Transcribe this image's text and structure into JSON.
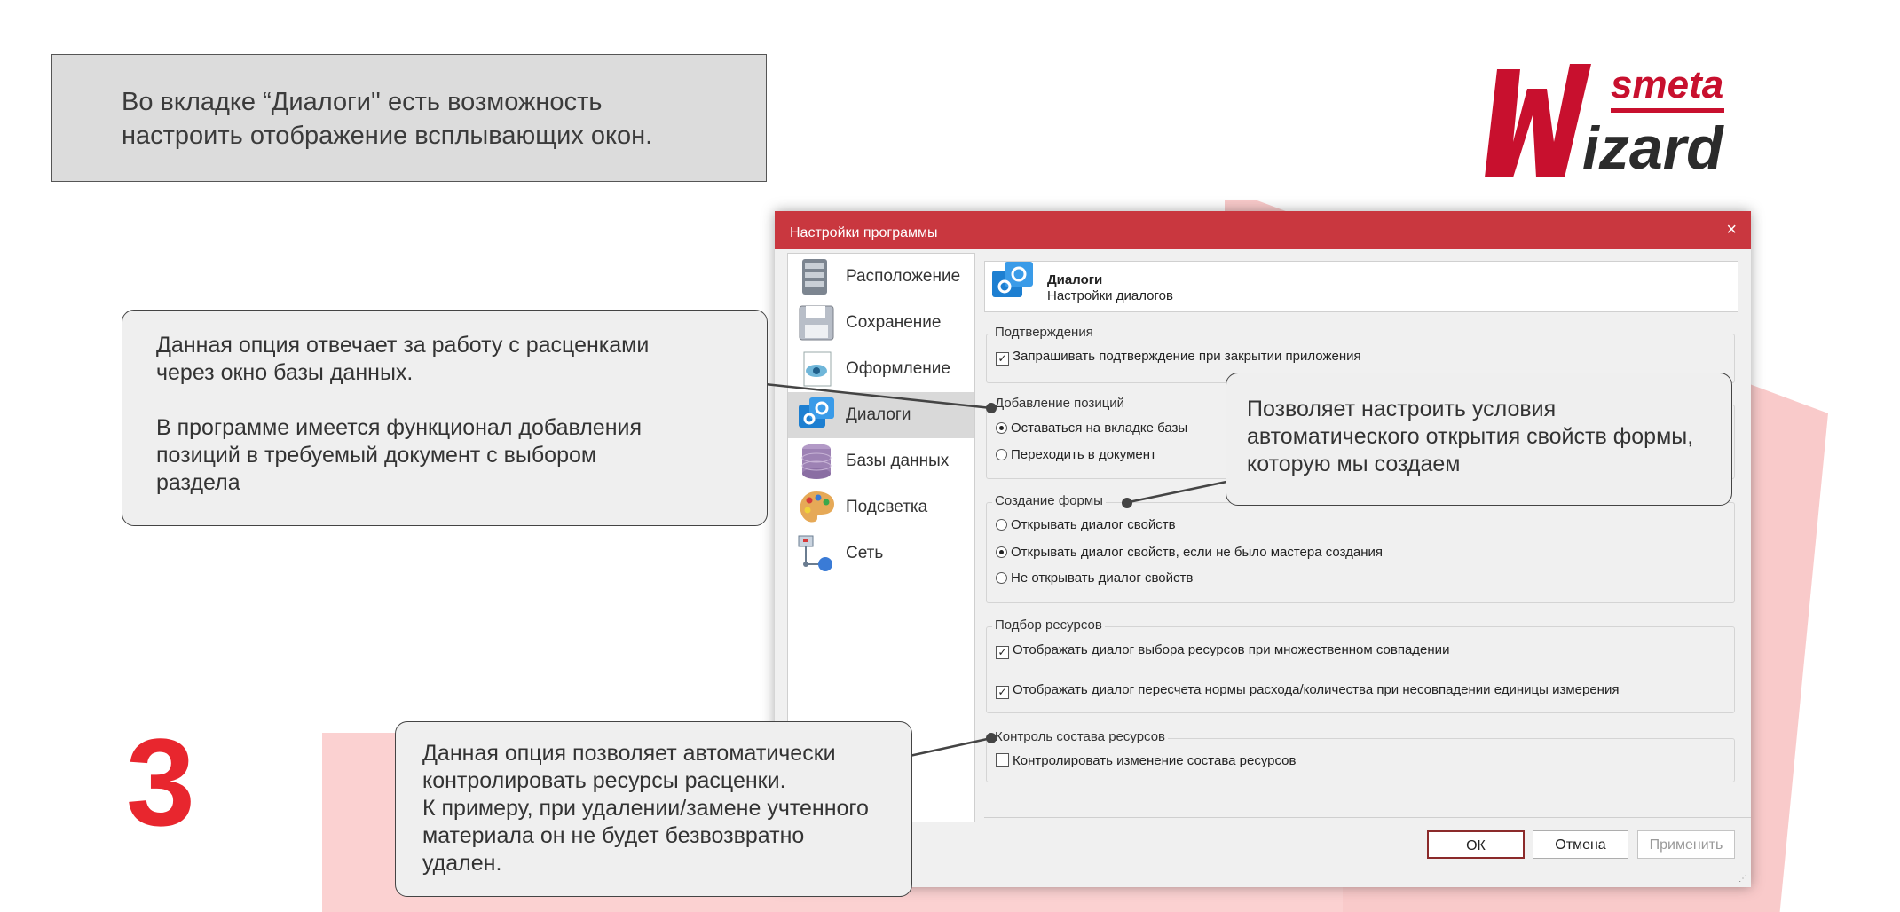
{
  "intro": {
    "line1": "Во вкладке “Диалоги'' есть возможность",
    "line2": "настроить отображение всплывающих окон."
  },
  "logo": {
    "top_text": "smeta",
    "main_text": "Wizard",
    "color": "#c8102e"
  },
  "step_number": "3",
  "window": {
    "title": "Настройки программы",
    "close": "×",
    "sidebar": [
      {
        "label": "Расположение",
        "icon": "server-icon"
      },
      {
        "label": "Сохранение",
        "icon": "floppy-disk-icon"
      },
      {
        "label": "Оформление",
        "icon": "eye-document-icon"
      },
      {
        "label": "Диалоги",
        "icon": "dialog-gear-icon",
        "active": true
      },
      {
        "label": "Базы данных",
        "icon": "database-icon"
      },
      {
        "label": "Подсветка",
        "icon": "palette-icon"
      },
      {
        "label": "Сеть",
        "icon": "network-icon"
      }
    ],
    "panel": {
      "title": "Диалоги",
      "subtitle": "Настройки диалогов"
    },
    "groups": {
      "confirm": {
        "title": "Подтверждения",
        "options": [
          {
            "label": "Запрашивать подтверждение при закрытии приложения",
            "checked": true
          }
        ]
      },
      "add_positions": {
        "title": "Добавление позиций",
        "options": [
          {
            "label": "Оставаться на вкладке базы",
            "selected": true
          },
          {
            "label": "Переходить в документ",
            "selected": false
          }
        ]
      },
      "form_create": {
        "title": "Создание формы",
        "options": [
          {
            "label": "Открывать диалог свойств",
            "selected": false
          },
          {
            "label": "Открывать диалог свойств, если не было мастера создания",
            "selected": true
          },
          {
            "label": "Не открывать диалог свойств",
            "selected": false
          }
        ]
      },
      "resources": {
        "title": "Подбор ресурсов",
        "options": [
          {
            "label": "Отображать диалог выбора ресурсов при множественном совпадении",
            "checked": true
          },
          {
            "label": "Отображать диалог пересчета нормы расхода/количества при несовпадении единицы измерения",
            "checked": true
          }
        ]
      },
      "control": {
        "title": "Контроль состава ресурсов",
        "options": [
          {
            "label": "Контролировать изменение состава ресурсов",
            "checked": false
          }
        ]
      }
    },
    "buttons": {
      "ok": "ОК",
      "cancel": "Отмена",
      "apply": "Применить"
    }
  },
  "callouts": {
    "left": {
      "l1": "Данная опция отвечает за работу с расценками",
      "l2": "через окно базы данных.",
      "l3": "В программе имеется функционал добавления",
      "l4": "позиций в требуемый документ с выбором",
      "l5": "раздела"
    },
    "right": {
      "l1": "Позволяет настроить условия",
      "l2": "автоматического открытия свойств формы,",
      "l3": "которую мы создаем"
    },
    "bottom": {
      "l1": "Данная опция позволяет автоматически",
      "l2": "контролировать ресурсы расценки.",
      "l3": "К примеру, при удалении/замене учтенного",
      "l4": "материала он не будет безвозвратно",
      "l5": "удален."
    }
  }
}
